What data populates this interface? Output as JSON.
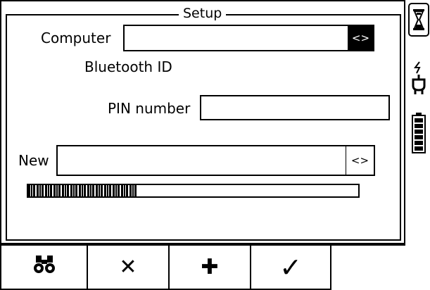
{
  "window": {
    "title": "Setup"
  },
  "computer": {
    "label": "Computer",
    "value": "",
    "select_label": "<>"
  },
  "bluetooth": {
    "label": "Bluetooth ID"
  },
  "pin": {
    "label": "PIN number",
    "value": ""
  },
  "new_entry": {
    "label": "New",
    "value": "",
    "select_label": "<>"
  },
  "progress": {
    "fraction": 0.33
  },
  "softkeys": [
    {
      "icon": "binoculars-icon",
      "label": ""
    },
    {
      "icon": "close-icon",
      "label": "✕"
    },
    {
      "icon": "plus-icon",
      "label": "✚"
    },
    {
      "icon": "check-icon",
      "label": "✓"
    },
    {
      "icon": "",
      "label": ""
    }
  ],
  "side_icons": [
    "hourglass-icon",
    "power-plug-icon",
    "battery-icon"
  ],
  "colors": {
    "foreground": "#000000",
    "background": "#ffffff"
  }
}
